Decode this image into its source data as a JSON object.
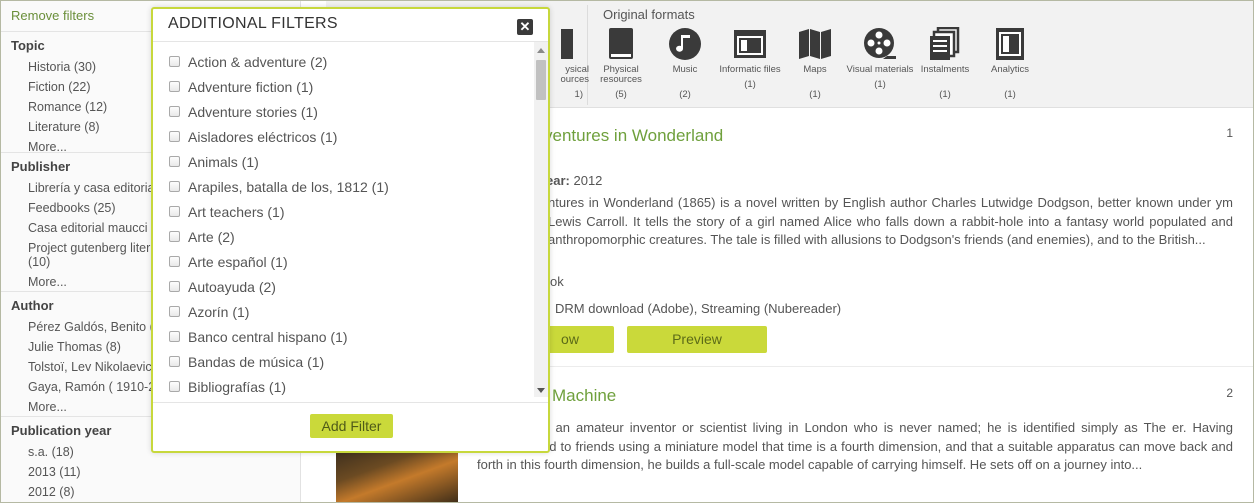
{
  "sidebar": {
    "remove_filters": "Remove filters",
    "facets": [
      {
        "title": "Topic",
        "items": [
          "Historia (30)",
          "Fiction (22)",
          "Romance (12)",
          "Literature (8)"
        ],
        "more": "More..."
      },
      {
        "title": "Publisher",
        "items": [
          "Librería y casa editoria",
          "Feedbooks (25)",
          "Casa editorial maucci (",
          "Project gutenberg liter",
          "(10)"
        ],
        "more": "More..."
      },
      {
        "title": "Author",
        "items": [
          "Pérez Galdós, Benito (",
          "Julie Thomas (8)",
          "Tolstoï, Lev Nikolaevich",
          "Gaya, Ramón ( 1910-20"
        ],
        "more": "More..."
      },
      {
        "title": "Publication year",
        "items": [
          "s.a. (18)",
          "2013 (11)",
          "2012 (8)"
        ],
        "more": ""
      }
    ]
  },
  "formats": {
    "title": "Original formats",
    "partial_left": {
      "label1": "ysical",
      "label2": "ources",
      "count": "1)"
    },
    "items": [
      {
        "label": "Physical resources",
        "count": "(5)",
        "icon": "book-icon"
      },
      {
        "label": "Music",
        "count": "(2)",
        "icon": "music-icon"
      },
      {
        "label": "Informatic files",
        "count": "(1)",
        "icon": "window-icon"
      },
      {
        "label": "Maps",
        "count": "(1)",
        "icon": "map-icon"
      },
      {
        "label": "Visual materials",
        "count": "(1)",
        "icon": "film-reel-icon"
      },
      {
        "label": "Instalments",
        "count": "(1)",
        "icon": "stacked-pages-icon"
      },
      {
        "label": "Analytics",
        "count": "(1)",
        "icon": "document-icon"
      }
    ]
  },
  "results": [
    {
      "number": "1",
      "title": "ventures in Wonderland",
      "author_fragment": "l",
      "year_label": "ear:",
      "year": "2012",
      "description": "ntures in Wonderland (1865) is a novel written by English author Charles Lutwidge Dodgson, better known under ym Lewis Carroll. It tells the story of a girl named Alice who falls down a rabbit-hole into a fantasy world populated and anthropomorphic creatures. The tale is filled with allusions to Dodgson's friends (and enemies), and to the British...",
      "format_fragment": "ok",
      "access": "DRM download (Adobe), Streaming (Nubereader)",
      "borrow_label": "ow",
      "preview_label": "Preview"
    },
    {
      "number": "2",
      "title": "Machine",
      "description": "rotagonist is an amateur inventor or scientist living in London who is never named; he is identified simply as The er. Having demonstrated to friends using a miniature model that time is a fourth dimension, and that a suitable apparatus can move back and forth in this fourth dimension, he builds a full-scale model capable of carrying himself. He sets off on a journey into..."
    }
  ],
  "modal": {
    "title": "ADDITIONAL FILTERS",
    "close_label": "✕",
    "options": [
      "Action & adventure (2)",
      "Adventure fiction (1)",
      "Adventure stories (1)",
      "Aisladores eléctricos (1)",
      "Animals (1)",
      "Arapiles, batalla de los, 1812 (1)",
      "Art teachers (1)",
      "Arte (2)",
      "Arte español (1)",
      "Autoayuda (2)",
      "Azorín (1)",
      "Banco central hispano (1)",
      "Bandas de música (1)",
      "Bibliografías (1)"
    ],
    "add_filter_label": "Add Filter"
  }
}
